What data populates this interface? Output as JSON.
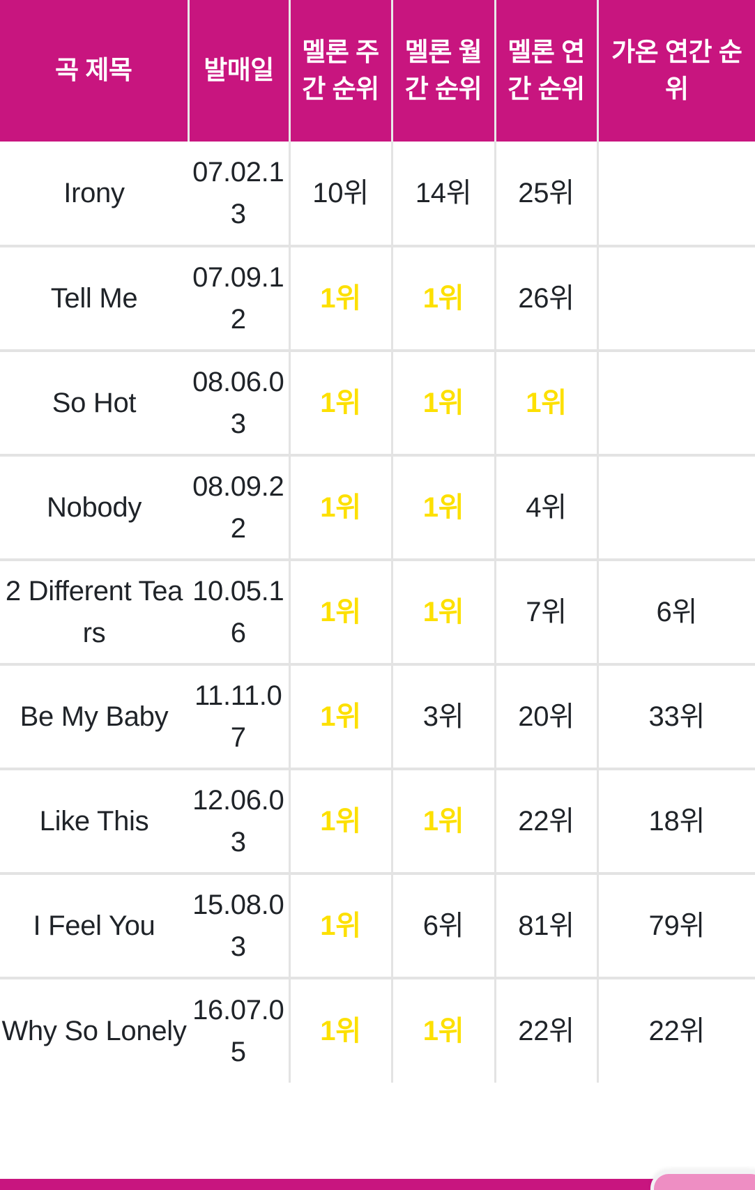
{
  "table": {
    "headers": [
      {
        "label": "곡 제목",
        "name": "song-title"
      },
      {
        "label": "발매일",
        "name": "release-date"
      },
      {
        "label": "멜론 주간 순위",
        "name": "melon-weekly-rank"
      },
      {
        "label": "멜론 월간 순위",
        "name": "melon-monthly-rank"
      },
      {
        "label": "멜론 연간 순위",
        "name": "melon-yearly-rank"
      },
      {
        "label": "가온 연간 순위",
        "name": "gaon-yearly-rank"
      }
    ],
    "rows": [
      {
        "title": "Irony",
        "date": "07.02.13",
        "melon_weekly": "10위",
        "melon_monthly": "14위",
        "melon_yearly": "25위",
        "gaon_yearly": ""
      },
      {
        "title": "Tell Me",
        "date": "07.09.12",
        "melon_weekly": "1위",
        "melon_monthly": "1위",
        "melon_yearly": "26위",
        "gaon_yearly": ""
      },
      {
        "title": "So Hot",
        "date": "08.06.03",
        "melon_weekly": "1위",
        "melon_monthly": "1위",
        "melon_yearly": "1위",
        "gaon_yearly": ""
      },
      {
        "title": "Nobody",
        "date": "08.09.22",
        "melon_weekly": "1위",
        "melon_monthly": "1위",
        "melon_yearly": "4위",
        "gaon_yearly": ""
      },
      {
        "title": "2 Different Tears",
        "date": "10.05.16",
        "melon_weekly": "1위",
        "melon_monthly": "1위",
        "melon_yearly": "7위",
        "gaon_yearly": "6위"
      },
      {
        "title": "Be My Baby",
        "date": "11.11.07",
        "melon_weekly": "1위",
        "melon_monthly": "3위",
        "melon_yearly": "20위",
        "gaon_yearly": "33위"
      },
      {
        "title": "Like This",
        "date": "12.06.03",
        "melon_weekly": "1위",
        "melon_monthly": "1위",
        "melon_yearly": "22위",
        "gaon_yearly": "18위"
      },
      {
        "title": "I Feel You",
        "date": "15.08.03",
        "melon_weekly": "1위",
        "melon_monthly": "6위",
        "melon_yearly": "81위",
        "gaon_yearly": "79위"
      },
      {
        "title": "Why So Lonely",
        "date": "16.07.05",
        "melon_weekly": "1위",
        "melon_monthly": "1위",
        "melon_yearly": "22위",
        "gaon_yearly": "22위"
      }
    ]
  },
  "colors": {
    "header_background": "#C8157F",
    "header_text": "#FFFFFF",
    "first_place_text": "#FDE000",
    "body_text": "#1F2328",
    "grid_line": "#E3E3E3",
    "footer_bar": "#C8157F",
    "floating_chip": "#EE8EC3"
  },
  "highlight": {
    "first_place_value": "1위"
  }
}
